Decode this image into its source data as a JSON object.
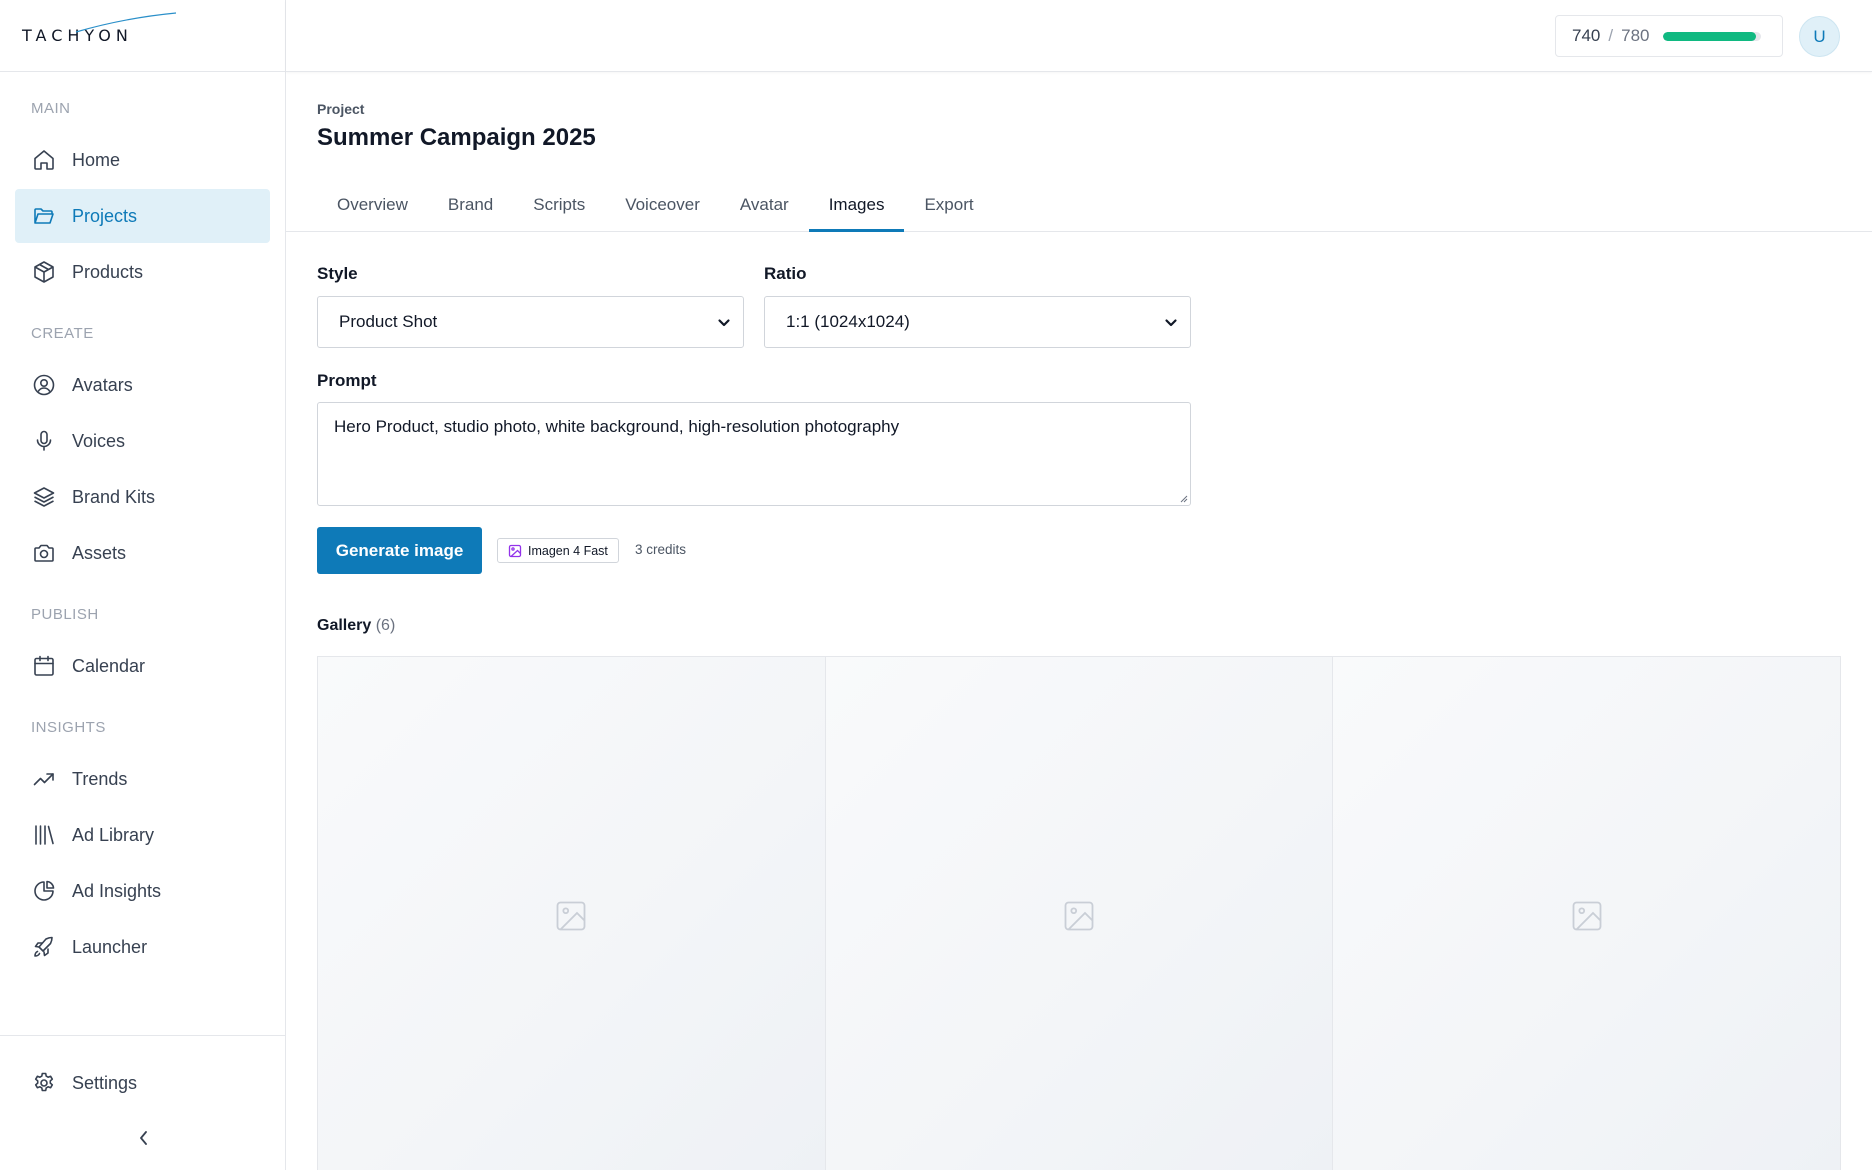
{
  "logo": {
    "text": "TACHYON"
  },
  "sidebar": {
    "sections": [
      {
        "label": "MAIN",
        "items": [
          {
            "label": "Home",
            "icon": "home-icon"
          },
          {
            "label": "Projects",
            "icon": "folder-open-icon",
            "active": true
          },
          {
            "label": "Products",
            "icon": "box-icon"
          }
        ]
      },
      {
        "label": "CREATE",
        "items": [
          {
            "label": "Avatars",
            "icon": "user-circle-icon"
          },
          {
            "label": "Voices",
            "icon": "microphone-icon"
          },
          {
            "label": "Brand Kits",
            "icon": "layers-icon"
          },
          {
            "label": "Assets",
            "icon": "camera-icon"
          }
        ]
      },
      {
        "label": "PUBLISH",
        "items": [
          {
            "label": "Calendar",
            "icon": "calendar-icon"
          }
        ]
      },
      {
        "label": "INSIGHTS",
        "items": [
          {
            "label": "Trends",
            "icon": "trending-up-icon"
          },
          {
            "label": "Ad Library",
            "icon": "library-icon"
          },
          {
            "label": "Ad Insights",
            "icon": "pie-chart-icon"
          },
          {
            "label": "Launcher",
            "icon": "rocket-icon"
          }
        ]
      }
    ],
    "settings_label": "Settings"
  },
  "topbar": {
    "credits_used": "740",
    "credits_separator": "/",
    "credits_total": "780",
    "credits_fraction": 0.949,
    "avatar_initial": "U"
  },
  "project": {
    "breadcrumb": "Project",
    "title": "Summer Campaign 2025",
    "tabs": [
      "Overview",
      "Brand",
      "Scripts",
      "Voiceover",
      "Avatar",
      "Images",
      "Export"
    ],
    "active_tab": "Images"
  },
  "form": {
    "style_label": "Style",
    "style_value": "Product Shot",
    "ratio_label": "Ratio",
    "ratio_value": "1:1 (1024x1024)",
    "prompt_label": "Prompt",
    "prompt_value": "Hero Product, studio photo, white background, high-resolution photography",
    "generate_label": "Generate image",
    "model_label": "Imagen 4 Fast",
    "cost_label": "3 credits"
  },
  "gallery": {
    "title": "Gallery",
    "count": "(6)"
  },
  "colors": {
    "accent": "#0e7ab8",
    "active_bg": "#e0f0f8",
    "progress": "#10b981",
    "model_icon": "#9333ea"
  }
}
